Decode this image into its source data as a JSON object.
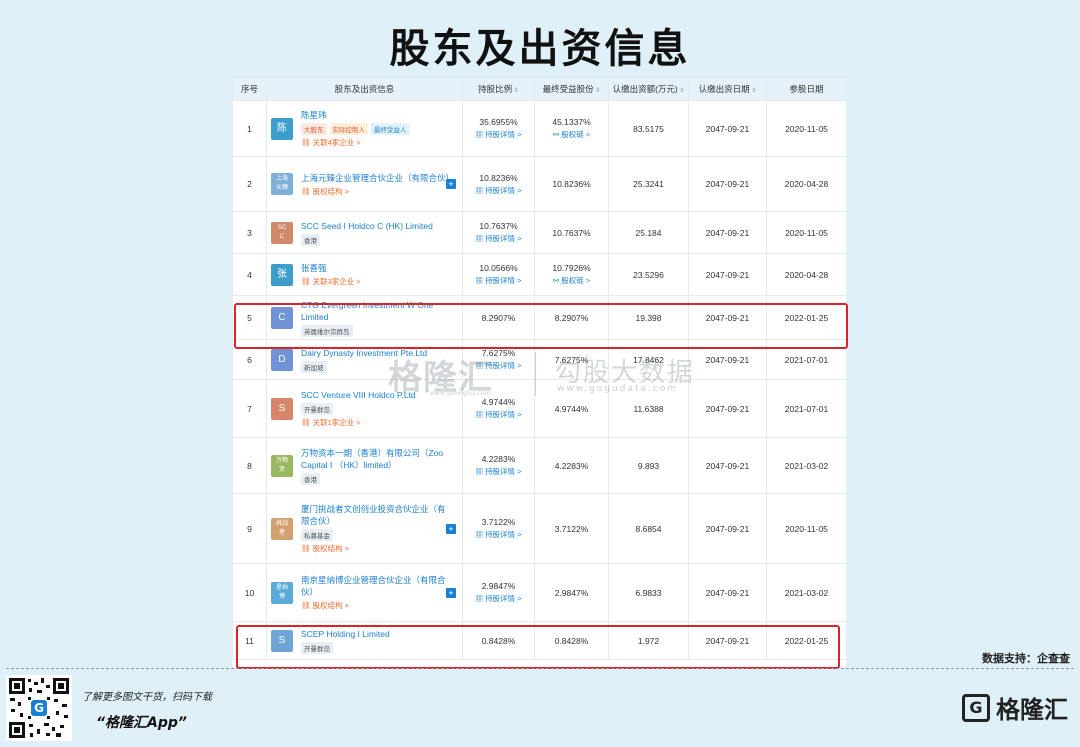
{
  "page_title": "股东及出资信息",
  "headers": [
    "序号",
    "股东及出资信息",
    "持股比例",
    "最终受益股份",
    "认缴出资额(万元)",
    "认缴出资日期",
    "参股日期"
  ],
  "sort_icon": "⇕",
  "rows": [
    {
      "no": "1",
      "avatar": "陈",
      "avatar_color": "#3d9ecb",
      "name": "陈星玮",
      "tags": [
        {
          "text": "大股东",
          "fg": "#e8572d",
          "bg": "#fde8e0"
        },
        {
          "text": "实际控制人",
          "fg": "#e8572d",
          "bg": "#fdf0da"
        },
        {
          "text": "最终受益人",
          "fg": "#2c8ac6",
          "bg": "#e3f1fb"
        }
      ],
      "rel": "关联4家企业 >",
      "plus": false,
      "ratio": "35.6955%",
      "ratio_det": "持股详情 >",
      "benefit": "45.1337%",
      "benefit_det": "股权链 >",
      "amount": "83.5175",
      "date": "2047-09-21",
      "join": "2020-11-05"
    },
    {
      "no": "2",
      "avatar": "上海\n元臻",
      "avatar_color": "#7fb0d8",
      "small": true,
      "name": "上海元臻企业管理合伙企业（有限合伙）",
      "tags": [],
      "rel": "股权结构 >",
      "plus": true,
      "ratio": "10.8236%",
      "ratio_det": "持股详情 >",
      "benefit": "10.8236%",
      "benefit_det": "",
      "amount": "25.3241",
      "date": "2047-09-21",
      "join": "2020-04-28"
    },
    {
      "no": "3",
      "avatar": "SC\nC",
      "avatar_color": "#d08a6a",
      "small": true,
      "name": "SCC Seed I Holdco C (HK) Limited",
      "tags": [
        {
          "text": "香港",
          "fg": "#555",
          "bg": "#e8eef5"
        }
      ],
      "rel": "",
      "plus": false,
      "ratio": "10.7637%",
      "ratio_det": "持股详情 >",
      "benefit": "10.7637%",
      "benefit_det": "",
      "amount": "25.184",
      "date": "2047-09-21",
      "join": "2020-11-05"
    },
    {
      "no": "4",
      "avatar": "张",
      "avatar_color": "#3d9ecb",
      "name": "张喜强",
      "tags": [],
      "rel": "关联3家企业 >",
      "plus": false,
      "ratio": "10.0566%",
      "ratio_det": "持股详情 >",
      "benefit": "10.7926%",
      "benefit_det": "股权链 >",
      "amount": "23.5296",
      "date": "2047-09-21",
      "join": "2020-04-28"
    },
    {
      "no": "5",
      "avatar": "C",
      "avatar_color": "#6f93d6",
      "name": "CTG Evergreen Investment W One Limited",
      "tags": [
        {
          "text": "英属维尔京群岛",
          "fg": "#555",
          "bg": "#e8eef5"
        }
      ],
      "rel": "",
      "plus": false,
      "ratio": "8.2907%",
      "ratio_det": "",
      "benefit": "8.2907%",
      "benefit_det": "",
      "amount": "19.398",
      "date": "2047-09-21",
      "join": "2022-01-25"
    },
    {
      "no": "6",
      "avatar": "D",
      "avatar_color": "#6f93d6",
      "name": "Dairy Dynasty Investment Pte.Ltd",
      "tags": [
        {
          "text": "新加坡",
          "fg": "#555",
          "bg": "#e8eef5"
        }
      ],
      "rel": "",
      "plus": false,
      "ratio": "7.6275%",
      "ratio_det": "持股详情 >",
      "benefit": "7.6275%",
      "benefit_det": "",
      "amount": "17.8462",
      "date": "2047-09-21",
      "join": "2021-07-01"
    },
    {
      "no": "7",
      "avatar": "S",
      "avatar_color": "#d8866a",
      "name": "SCC Venture VIII Holdco P.Ltd",
      "tags": [
        {
          "text": "开曼群岛",
          "fg": "#555",
          "bg": "#e8eef5"
        }
      ],
      "rel": "关联1家企业 >",
      "plus": false,
      "ratio": "4.9744%",
      "ratio_det": "持股详情 >",
      "benefit": "4.9744%",
      "benefit_det": "",
      "amount": "11.6388",
      "date": "2047-09-21",
      "join": "2021-07-01"
    },
    {
      "no": "8",
      "avatar": "万物\n资",
      "avatar_color": "#9ab860",
      "small": true,
      "name": "万物资本一期（香港）有限公司（Zoo Capital Ⅰ （HK）limited）",
      "tags": [
        {
          "text": "香港",
          "fg": "#555",
          "bg": "#e8eef5"
        }
      ],
      "rel": "",
      "plus": false,
      "ratio": "4.2283%",
      "ratio_det": "持股详情 >",
      "benefit": "4.2283%",
      "benefit_det": "",
      "amount": "9.893",
      "date": "2047-09-21",
      "join": "2021-03-02"
    },
    {
      "no": "9",
      "avatar": "挑战\n者",
      "avatar_color": "#d4a070",
      "small": true,
      "name": "厦门挑战者文创创业投资合伙企业（有限合伙）",
      "tags": [
        {
          "text": "私募基金",
          "fg": "#555",
          "bg": "#e8eef5"
        }
      ],
      "rel": "股权结构 >",
      "plus": true,
      "ratio": "3.7122%",
      "ratio_det": "持股详情 >",
      "benefit": "3.7122%",
      "benefit_det": "",
      "amount": "8.6854",
      "date": "2047-09-21",
      "join": "2020-11-05"
    },
    {
      "no": "10",
      "avatar": "星纳\n博",
      "avatar_color": "#5aa9d6",
      "small": true,
      "name": "南京星纳博企业管理合伙企业（有限合伙）",
      "tags": [],
      "rel": "股权结构 >",
      "plus": true,
      "ratio": "2.9847%",
      "ratio_det": "持股详情 >",
      "benefit": "2.9847%",
      "benefit_det": "",
      "amount": "6.9833",
      "date": "2047-09-21",
      "join": "2021-03-02"
    },
    {
      "no": "11",
      "avatar": "S",
      "avatar_color": "#6fa5d6",
      "name": "SCEP Holding I Limited",
      "tags": [
        {
          "text": "开曼群岛",
          "fg": "#555",
          "bg": "#e8eef5"
        }
      ],
      "rel": "",
      "plus": false,
      "ratio": "0.8428%",
      "ratio_det": "",
      "benefit": "0.8428%",
      "benefit_det": "",
      "amount": "1.972",
      "date": "2047-09-21",
      "join": "2022-01-25"
    }
  ],
  "watermark": {
    "brand": "格隆汇",
    "brand_sub": "www.gelonghui.com",
    "gogu": "勾股大数据",
    "gogu_sub": "www.gogudata.com"
  },
  "support_text": "数据支持：企查查",
  "footer": {
    "line1": "了解更多图文干货，扫码下载",
    "line2": "“格隆汇App”",
    "logo_mark": "G",
    "logo_text": "格隆汇"
  }
}
